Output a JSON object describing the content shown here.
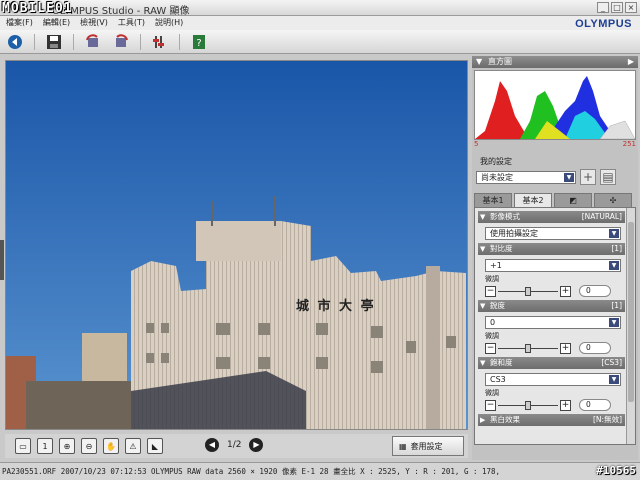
{
  "watermark": "MOBILE01",
  "watermark_id": "#10565",
  "app_title": "OLYMPUS Studio - RAW 顯像",
  "brand_logo": "OLYMPUS",
  "menu": [
    "檔案(F)",
    "編輯(E)",
    "檢視(V)",
    "工具(T)",
    "說明(H)"
  ],
  "toolbar_icons": [
    "back-icon",
    "save-icon",
    "rotate-left-icon",
    "rotate-right-icon",
    "settings-icon",
    "help-icon"
  ],
  "nav": {
    "page": "1/2",
    "prev": "◀",
    "next": "▶"
  },
  "apply_button": "套用設定",
  "status": "PA230551.ORF  2007/10/23 07:12:53  OLYMPUS RAW data  2560 × 1920 像素  E-1  28 畫全比  X : 2525, Y :   R : 201, G : 178,",
  "panel": {
    "histogram_title": "直方圖",
    "hist_min": "5",
    "hist_max": "251",
    "preset_label": "我的設定",
    "preset_value": "尚未設定",
    "tabs": [
      "基本1",
      "基本2",
      "",
      ""
    ],
    "sections": [
      {
        "title": "影像模式",
        "value": "[NATURAL]",
        "select": "使用拍攝設定",
        "has_slider": false
      },
      {
        "title": "對比度",
        "value": "[1]",
        "select": "+1",
        "fine": "微調",
        "num": "0",
        "has_slider": true
      },
      {
        "title": "銳度",
        "value": "[1]",
        "select": "0",
        "fine": "微調",
        "num": "0",
        "has_slider": true
      },
      {
        "title": "飽和度",
        "value": "[CS3]",
        "select": "CS3",
        "fine": "微調",
        "num": "0",
        "has_slider": true
      },
      {
        "title": "黑白效果",
        "value": "[N:無效]",
        "select": "",
        "has_slider": false
      }
    ]
  },
  "photo_sign": "城 市 大 亭",
  "colors": {
    "sky": "#1e5fae",
    "building": "#d8cfc4",
    "accent": "#3a4a7a"
  }
}
